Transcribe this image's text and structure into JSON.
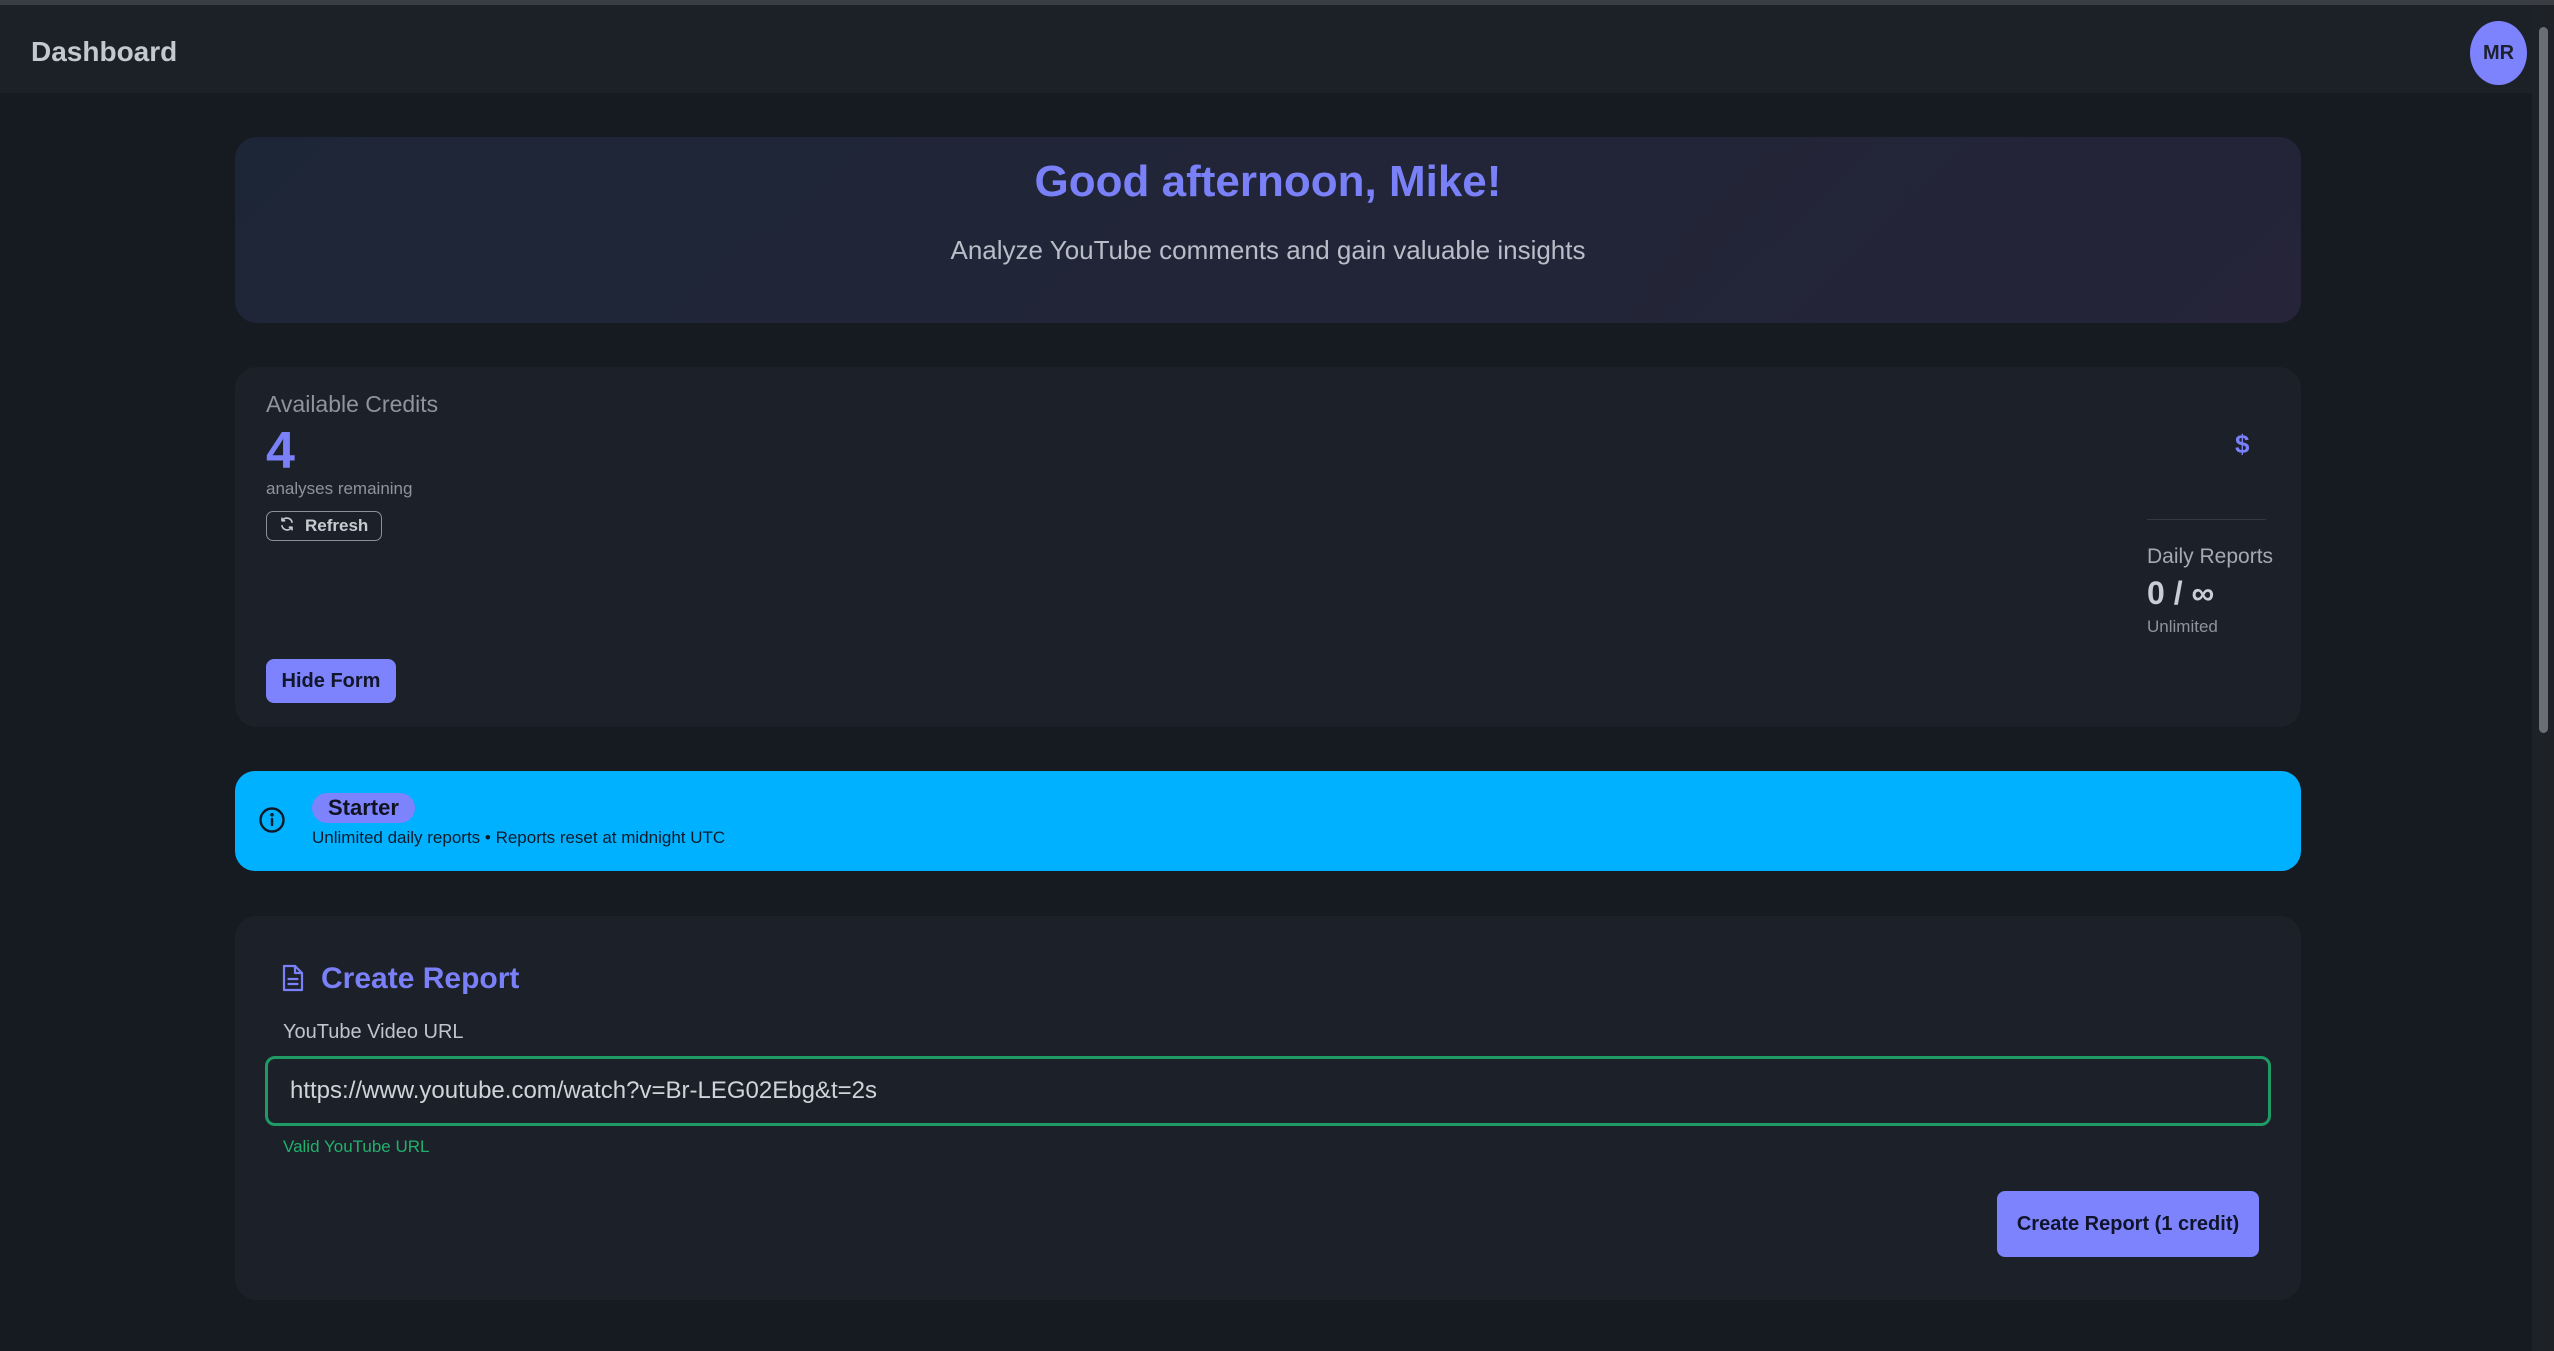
{
  "header": {
    "title": "Dashboard",
    "avatar_initials": "MR"
  },
  "greeting": {
    "title": "Good afternoon, Mike!",
    "subtitle": "Analyze YouTube comments and gain valuable insights"
  },
  "credits": {
    "label": "Available Credits",
    "value": "4",
    "note": "analyses remaining",
    "refresh_label": "Refresh",
    "hide_form_label": "Hide Form",
    "currency_symbol": "$"
  },
  "daily_reports": {
    "label": "Daily Reports",
    "value": "0 / ∞",
    "note": "Unlimited"
  },
  "plan_banner": {
    "plan_name": "Starter",
    "note": "Unlimited daily reports • Reports reset at midnight UTC",
    "background": "#00b1ff"
  },
  "create_report": {
    "title": "Create Report",
    "url_label": "YouTube Video URL",
    "url_value": "https://www.youtube.com/watch?v=Br-LEG02Ebg&t=2s",
    "validation_text": "Valid YouTube URL",
    "submit_label": "Create Report (1 credit)"
  },
  "colors": {
    "accent": "#7c83fc",
    "success": "#22b06d",
    "background": "#161b22"
  }
}
